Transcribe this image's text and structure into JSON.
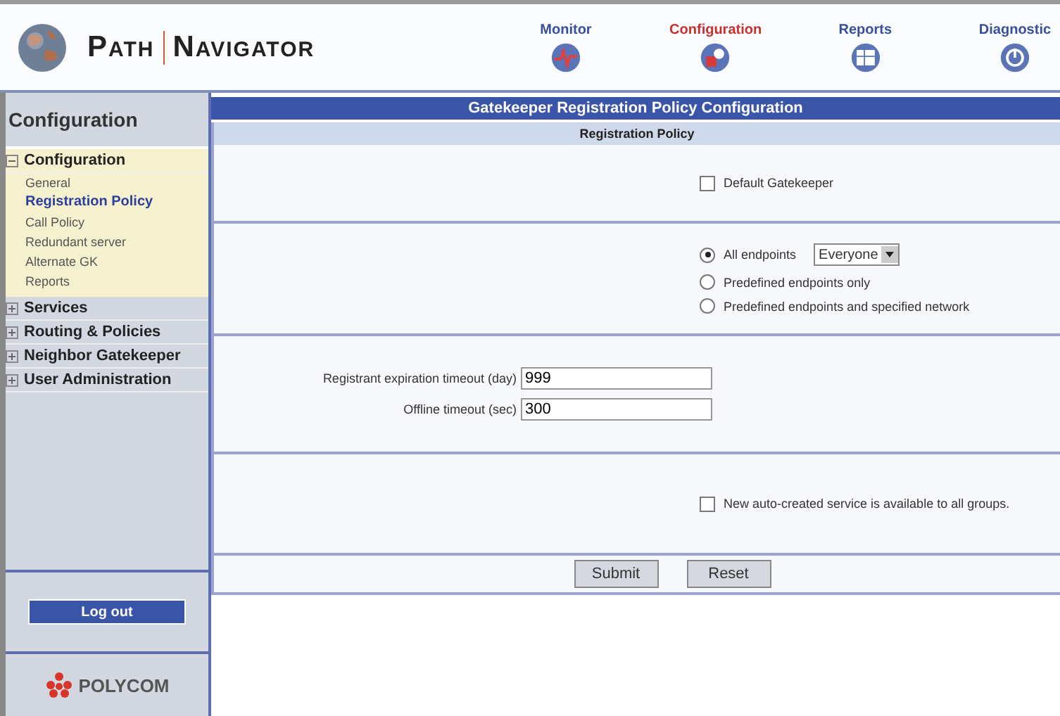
{
  "header": {
    "brand_left": "Path",
    "brand_right": "Navigator",
    "nav": [
      {
        "label": "Monitor",
        "selected": false
      },
      {
        "label": "Configuration",
        "selected": true
      },
      {
        "label": "Reports",
        "selected": false
      },
      {
        "label": "Diagnostic",
        "selected": false
      }
    ]
  },
  "sidebar": {
    "title": "Configuration",
    "tree": [
      {
        "label": "Configuration",
        "expanded": true,
        "children": [
          {
            "label": "General",
            "selected": false
          },
          {
            "label": "Registration Policy",
            "selected": true
          },
          {
            "label": "Call Policy",
            "selected": false
          },
          {
            "label": "Redundant server",
            "selected": false
          },
          {
            "label": "Alternate GK",
            "selected": false
          },
          {
            "label": "Reports",
            "selected": false
          }
        ]
      },
      {
        "label": "Services",
        "expanded": false
      },
      {
        "label": "Routing & Policies",
        "expanded": false
      },
      {
        "label": "Neighbor Gatekeeper",
        "expanded": false
      },
      {
        "label": "User Administration",
        "expanded": false
      }
    ],
    "logout": "Log out",
    "company": "POLYCOM"
  },
  "main": {
    "title": "Gatekeeper Registration Policy Configuration",
    "subtitle": "Registration Policy",
    "sections": [
      {
        "kind": "checkbox",
        "label": "Default Gatekeeper",
        "checked": false
      },
      {
        "kind": "radios",
        "options": [
          {
            "label": "All endpoints",
            "selected": true,
            "dropdown": "Everyone"
          },
          {
            "label": "Predefined endpoints only",
            "selected": false
          },
          {
            "label": "Predefined endpoints and specified network",
            "selected": false
          }
        ]
      },
      {
        "kind": "fields",
        "fields": [
          {
            "label": "Registrant expiration timeout (day)",
            "value": "999"
          },
          {
            "label": "Offline timeout (sec)",
            "value": "300"
          }
        ]
      },
      {
        "kind": "checkbox",
        "label": "New auto-created service is available to all groups.",
        "checked": false
      }
    ],
    "buttons": [
      "Submit",
      "Reset"
    ]
  }
}
